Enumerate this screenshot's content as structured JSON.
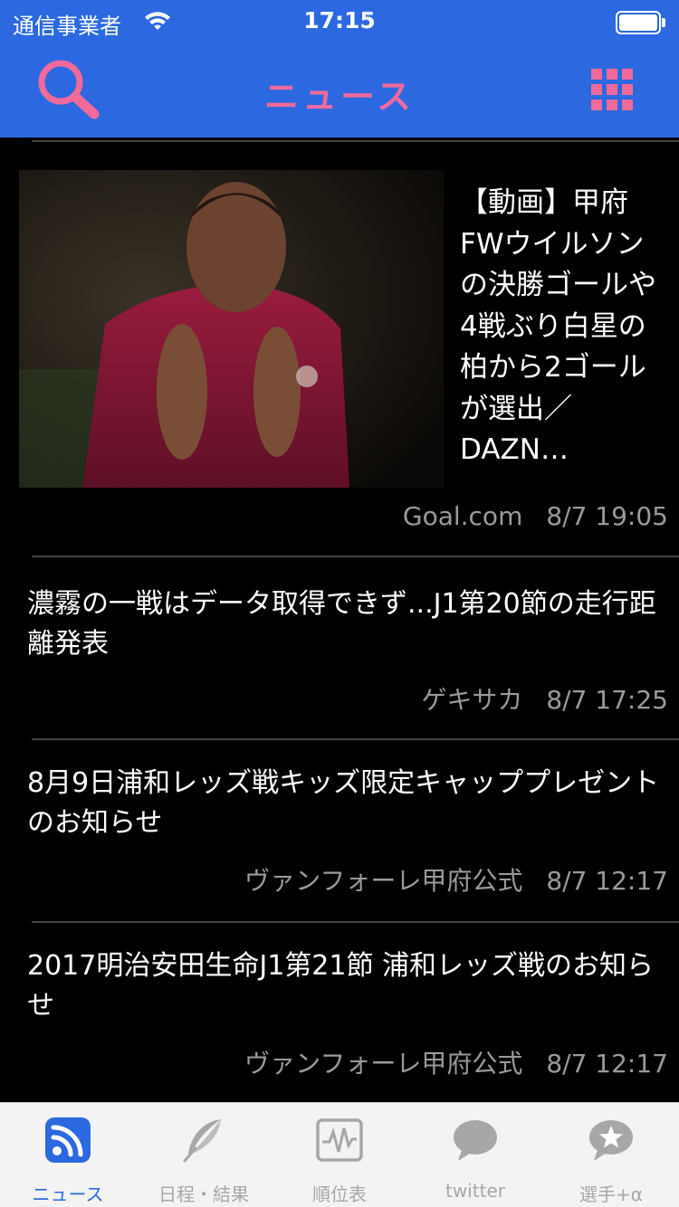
{
  "status_bar": {
    "carrier": "通信事業者",
    "time": "17:15"
  },
  "nav": {
    "title": "ニュース",
    "search_icon": "search-icon",
    "menu_icon": "grid-menu-icon",
    "accent_color": "#f06a9b",
    "bar_color": "#2c69e0"
  },
  "articles": [
    {
      "title": "【動画】甲府FWウイルソンの決勝ゴールや4戦ぶり白星の柏から2ゴールが選出／DAZN…",
      "source": "Goal.com",
      "date": "8/7 19:05",
      "has_image": true
    },
    {
      "title": "濃霧の一戦はデータ取得できず...J1第20節の走行距離発表",
      "source": "ゲキサカ",
      "date": "8/7 17:25"
    },
    {
      "title": "8月9日浦和レッズ戦キッズ限定キャッププレゼントのお知らせ",
      "source": "ヴァンフォーレ甲府公式",
      "date": "8/7 12:17"
    },
    {
      "title": "2017明治安田生命J1第21節 浦和レッズ戦のお知らせ",
      "source": "ヴァンフォーレ甲府公式",
      "date": "8/7 12:17"
    }
  ],
  "tabs": [
    {
      "label": "ニュース",
      "icon": "rss-icon",
      "active": true
    },
    {
      "label": "日程・結果",
      "icon": "feather-icon",
      "active": false
    },
    {
      "label": "順位表",
      "icon": "chart-icon",
      "active": false
    },
    {
      "label": "twitter",
      "icon": "speech-bubble-icon",
      "active": false
    },
    {
      "label": "選手+α",
      "icon": "star-bubble-icon",
      "active": false
    }
  ]
}
